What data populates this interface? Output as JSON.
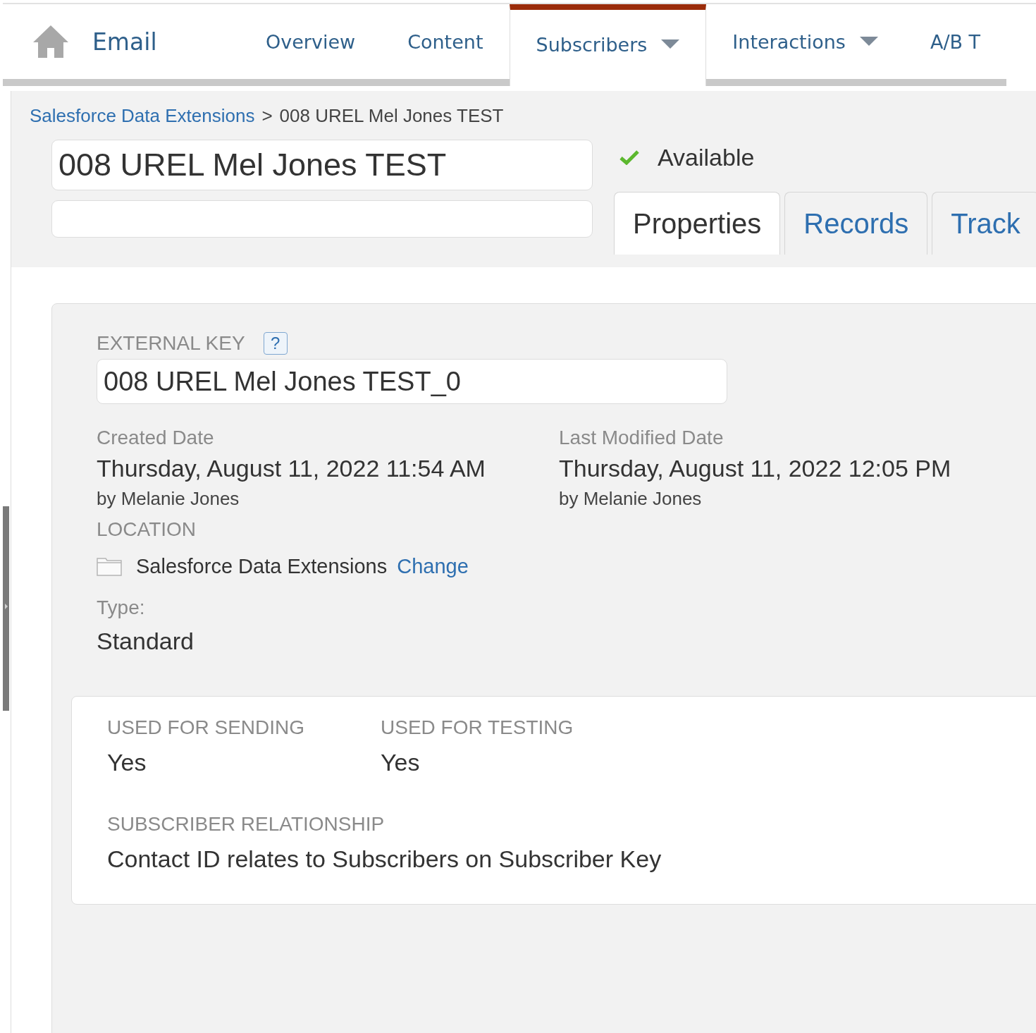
{
  "nav": {
    "title": "Email",
    "items": [
      {
        "label": "Overview",
        "selected": false,
        "dropdown": false
      },
      {
        "label": "Content",
        "selected": false,
        "dropdown": false
      },
      {
        "label": "Subscribers",
        "selected": true,
        "dropdown": true
      },
      {
        "label": "Interactions",
        "selected": false,
        "dropdown": true
      },
      {
        "label": "A/B T",
        "selected": false,
        "dropdown": false
      }
    ]
  },
  "breadcrumb": {
    "parent": "Salesforce Data Extensions",
    "separator": ">",
    "current": "008 UREL Mel Jones TEST"
  },
  "name_field": {
    "value": "008 UREL Mel Jones TEST"
  },
  "status": {
    "label": "Available",
    "ok": true
  },
  "tabs": [
    {
      "label": "Properties",
      "selected": true
    },
    {
      "label": "Records",
      "selected": false
    },
    {
      "label": "Track",
      "selected": false
    }
  ],
  "properties": {
    "external_key": {
      "label": "EXTERNAL KEY",
      "help": "?",
      "value": "008 UREL Mel Jones TEST_0"
    },
    "dates": [
      {
        "label": "Created Date",
        "value": "Thursday, August 11, 2022 11:54 AM",
        "by": "by Melanie Jones"
      },
      {
        "label": "Last Modified Date",
        "value": "Thursday, August 11, 2022 12:05 PM",
        "by": "by Melanie Jones"
      }
    ],
    "location": {
      "label": "LOCATION",
      "folder": "Salesforce Data Extensions",
      "action": "Change"
    },
    "type": {
      "label": "Type:",
      "value": "Standard"
    }
  },
  "settings": {
    "fields": [
      {
        "label": "USED FOR SENDING",
        "value": "Yes"
      },
      {
        "label": "USED FOR TESTING",
        "value": "Yes"
      }
    ],
    "relationship": {
      "label": "SUBSCRIBER RELATIONSHIP",
      "value": "Contact ID relates to Subscribers on Subscriber Key"
    }
  }
}
